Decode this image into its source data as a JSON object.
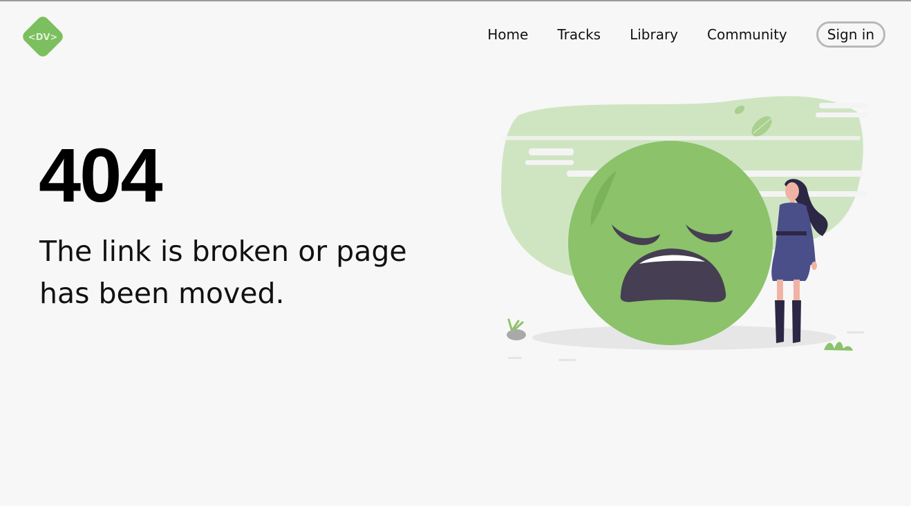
{
  "header": {
    "logo_text": "<DV>",
    "nav": [
      {
        "label": "Home"
      },
      {
        "label": "Tracks"
      },
      {
        "label": "Library"
      },
      {
        "label": "Community"
      }
    ],
    "signin_label": "Sign in"
  },
  "error": {
    "code": "404",
    "message": "The link is broken or page has been moved."
  },
  "colors": {
    "brand_green": "#7bbf5e",
    "face_green": "#8bc26a",
    "light_green": "#cfe5c2",
    "dark_purple": "#463e52",
    "dress_blue": "#4a4f8a",
    "background": "#f7f7f7"
  },
  "icons": {
    "logo": "diamond-logo-icon",
    "illustration": "sad-face-illustration"
  }
}
